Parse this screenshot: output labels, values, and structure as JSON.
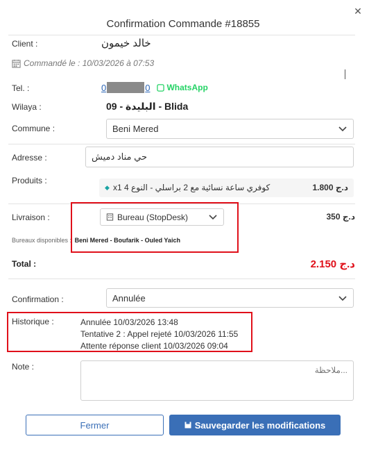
{
  "modal": {
    "title": "Confirmation Commande #18855",
    "close_icon": "✕"
  },
  "client": {
    "label": "Client :",
    "name": "خالد خيمون"
  },
  "ordered": {
    "text": "Commandé le : 10/03/2026 à 07:53"
  },
  "tel": {
    "label": "Tel. :",
    "visible_prefix": "0",
    "visible_suffix": "0",
    "whatsapp_label": "WhatsApp"
  },
  "wilaya": {
    "label": "Wilaya :",
    "value": "09 - البليدة - Blida"
  },
  "commune": {
    "label": "Commune :",
    "selected": "Beni Mered"
  },
  "adresse": {
    "label": "Adresse :",
    "value": "حي مناد دميش"
  },
  "produits": {
    "label": "Produits :",
    "item": "x1 كوفري ساعة نسائية مع 2 براسلي - النوع 4",
    "price": "1.800 د.ج"
  },
  "livraison": {
    "label": "Livraison :",
    "selected": "Bureau (StopDesk)",
    "price": "350 د.ج",
    "bureaux_label": "Bureaux disponibles :",
    "bureaux_list": "Beni Mered - Boufarik - Ouled Yaich"
  },
  "total": {
    "label": "Total :",
    "value": "2.150 د.ج"
  },
  "confirmation": {
    "label": "Confirmation :",
    "selected": "Annulée"
  },
  "historique": {
    "label": "Historique :",
    "entries": [
      "Annulée 10/03/2026 13:48",
      "Tentative 2 : Appel rejeté 10/03/2026 11:55",
      "Attente réponse client 10/03/2026 09:04"
    ]
  },
  "note": {
    "label": "Note :",
    "placeholder": "...ملاحظة"
  },
  "buttons": {
    "cancel": "Fermer",
    "save": "Sauvegarder les modifications"
  },
  "colors": {
    "accent": "#3a6fb7",
    "whatsapp": "#25d366",
    "danger": "#e0101a",
    "total": "#e0101a"
  }
}
